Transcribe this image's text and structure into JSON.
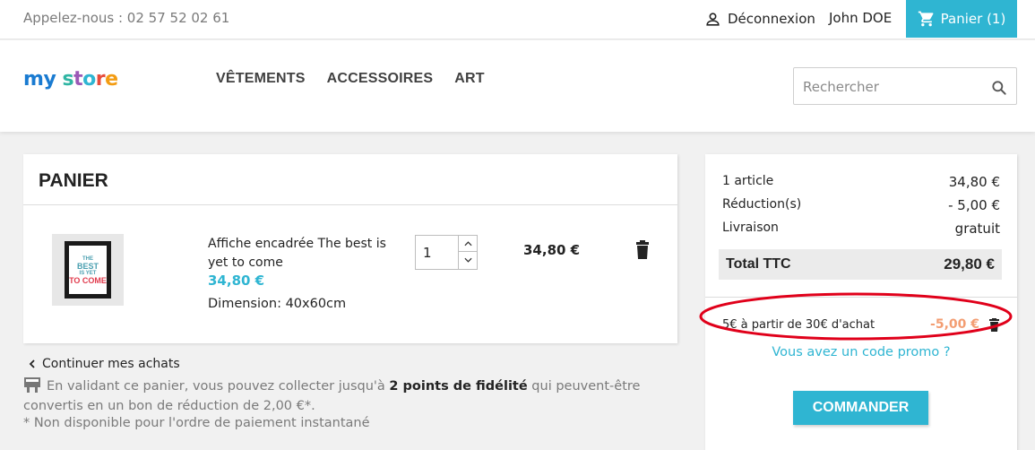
{
  "topbar": {
    "phone": "Appelez-nous : 02 57 52 02 61",
    "logout": "Déconnexion",
    "username": "John DOE",
    "cart_button": "Panier (1)"
  },
  "header": {
    "logo_text": [
      "m",
      "y",
      " ",
      "s",
      "t",
      "o",
      "r",
      "e"
    ],
    "logo_colors": [
      "#1a7bd1",
      "#1a7bd1",
      "",
      "#2fb5a3",
      "#9b59b6",
      "#2fb5d2",
      "#e74c3c",
      "#f39c12"
    ],
    "nav": [
      "VÊTEMENTS",
      "ACCESSOIRES",
      "ART"
    ],
    "search_placeholder": "Rechercher"
  },
  "cart": {
    "title": "PANIER",
    "items": [
      {
        "name": "Affiche encadrée The best is yet to come",
        "price": "34,80 €",
        "attribute": "Dimension: 40x60cm",
        "quantity": "1",
        "total": "34,80 €",
        "image_text": [
          "THE",
          "BEST",
          "IS YET",
          "TO COME"
        ]
      }
    ]
  },
  "continue_shopping": "Continuer mes achats",
  "loyalty": {
    "before": "En validant ce panier, vous pouvez collecter jusqu'à ",
    "points": "2 points de fidélité",
    "after": " qui peuvent-être convertis en un bon de réduction de 2,00 €*."
  },
  "note": "* Non disponible pour l'ordre de paiement instantané",
  "summary": {
    "rows": [
      {
        "label": "1 article",
        "value": "34,80 €"
      },
      {
        "label": "Réduction(s)",
        "value": "- 5,00 €"
      },
      {
        "label": "Livraison",
        "value": "gratuit"
      }
    ],
    "total_label": "Total TTC",
    "total_value": "29,80 €",
    "voucher_name": "5€ à partir de 30€ d'achat",
    "voucher_amount": "-5,00 €",
    "promo_link": "Vous avez un code promo ?",
    "checkout": "COMMANDER"
  },
  "colors": {
    "accent": "#2fb5d2",
    "discount": "#f39d72",
    "annotation": "#e0001a"
  }
}
